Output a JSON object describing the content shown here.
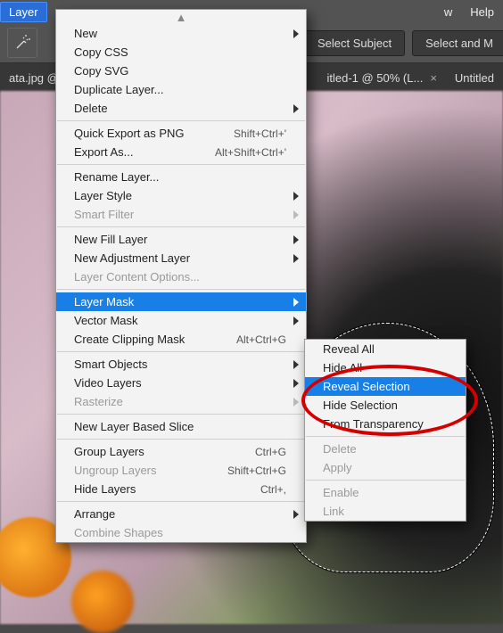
{
  "menubar": {
    "layer": "Layer",
    "window": "w",
    "help": "Help"
  },
  "toolbar": {
    "select_subject": "Select Subject",
    "select_mask": "Select and M"
  },
  "tabs": {
    "t1": "ata.jpg @",
    "t2": "itled-1 @ 50% (L...",
    "t3": "Untitled"
  },
  "menu": {
    "new": "New",
    "copy_css": "Copy CSS",
    "copy_svg": "Copy SVG",
    "duplicate": "Duplicate Layer...",
    "delete": "Delete",
    "quick_export": "Quick Export as PNG",
    "quick_export_sc": "Shift+Ctrl+'",
    "export_as": "Export As...",
    "export_as_sc": "Alt+Shift+Ctrl+'",
    "rename": "Rename Layer...",
    "layer_style": "Layer Style",
    "smart_filter": "Smart Filter",
    "new_fill": "New Fill Layer",
    "new_adj": "New Adjustment Layer",
    "layer_content": "Layer Content Options...",
    "layer_mask": "Layer Mask",
    "vector_mask": "Vector Mask",
    "clipping": "Create Clipping Mask",
    "clipping_sc": "Alt+Ctrl+G",
    "smart_obj": "Smart Objects",
    "video": "Video Layers",
    "rasterize": "Rasterize",
    "slice": "New Layer Based Slice",
    "group": "Group Layers",
    "group_sc": "Ctrl+G",
    "ungroup": "Ungroup Layers",
    "ungroup_sc": "Shift+Ctrl+G",
    "hide": "Hide Layers",
    "hide_sc": "Ctrl+,",
    "arrange": "Arrange",
    "combine": "Combine Shapes"
  },
  "submenu": {
    "reveal_all": "Reveal All",
    "hide_all": "Hide All",
    "reveal_sel": "Reveal Selection",
    "hide_sel": "Hide Selection",
    "from_trans": "From Transparency",
    "delete": "Delete",
    "apply": "Apply",
    "enable": "Enable",
    "link": "Link"
  }
}
